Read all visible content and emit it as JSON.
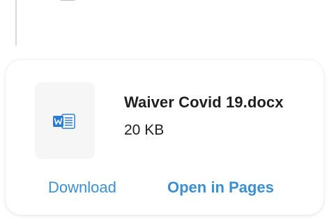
{
  "attachment": {
    "file_name": "Waiver Covid 19.docx",
    "file_size": "20 KB",
    "file_type_icon": "word-document-icon",
    "download_label": "Download",
    "open_label": "Open in Pages"
  },
  "colors": {
    "link": "#3b8fd1",
    "word_blue": "#2b7cd3",
    "text": "#1f1f1f",
    "tile_bg": "#f6f6f6"
  }
}
